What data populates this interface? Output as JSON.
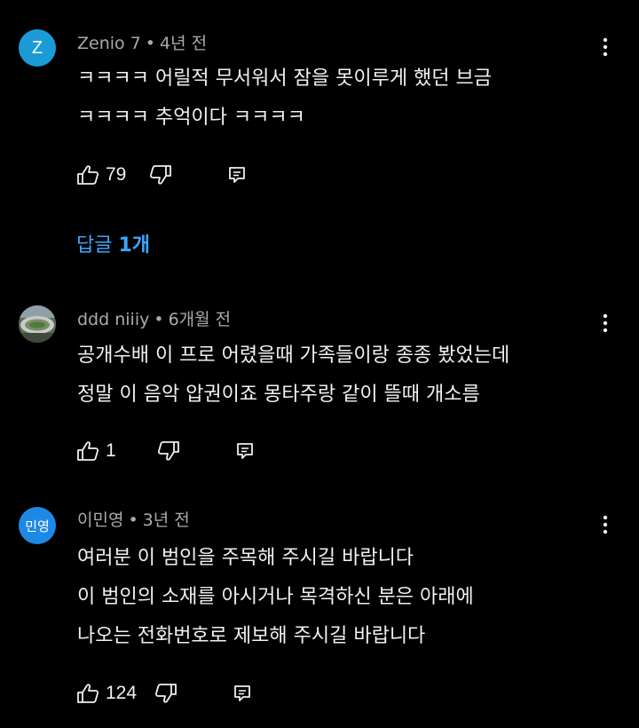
{
  "colors": {
    "background": "#000000",
    "text_primary": "#f1f1f1",
    "text_secondary": "#aaaaaa",
    "link_blue": "#3ea6ff",
    "avatar_z": "#1a9bd7",
    "avatar_minyoung": "#1e88e5"
  },
  "comments": [
    {
      "avatar_text": "Z",
      "avatar_icon": "letter-avatar",
      "author": "Zenio 7",
      "time": "4년 전",
      "lines": [
        "ㅋㅋㅋㅋ 어릴적 무서워서 잠을 못이루게 했던 브금",
        "ㅋㅋㅋㅋ 추억이다 ㅋㅋㅋㅋ"
      ],
      "likes": "79",
      "replies_prefix": "답글",
      "replies_count": "1개"
    },
    {
      "avatar_text": "",
      "avatar_icon": "stadium-photo-avatar",
      "author": "ddd niiiy",
      "time": "6개월 전",
      "lines": [
        "공개수배 이 프로 어렸을때 가족들이랑 종종 봤었는데",
        "정말 이 음악 압권이죠 몽타주랑 같이 뜰때 개소름"
      ],
      "likes": "1"
    },
    {
      "avatar_text": "민영",
      "avatar_icon": "letter-avatar",
      "author": "이민영",
      "time": "3년 전",
      "lines": [
        "여러분 이 범인을 주목해 주시길 바랍니다",
        "이 범인의 소재를 아시거나 목격하신 분은 아래에",
        "나오는 전화번호로 제보해 주시길 바랍니다"
      ],
      "likes": "124"
    }
  ],
  "meta_separator": "•",
  "icons": {
    "like": "thumbs-up-icon",
    "dislike": "thumbs-down-icon",
    "reply": "reply-comment-icon",
    "more": "more-vertical-icon"
  }
}
